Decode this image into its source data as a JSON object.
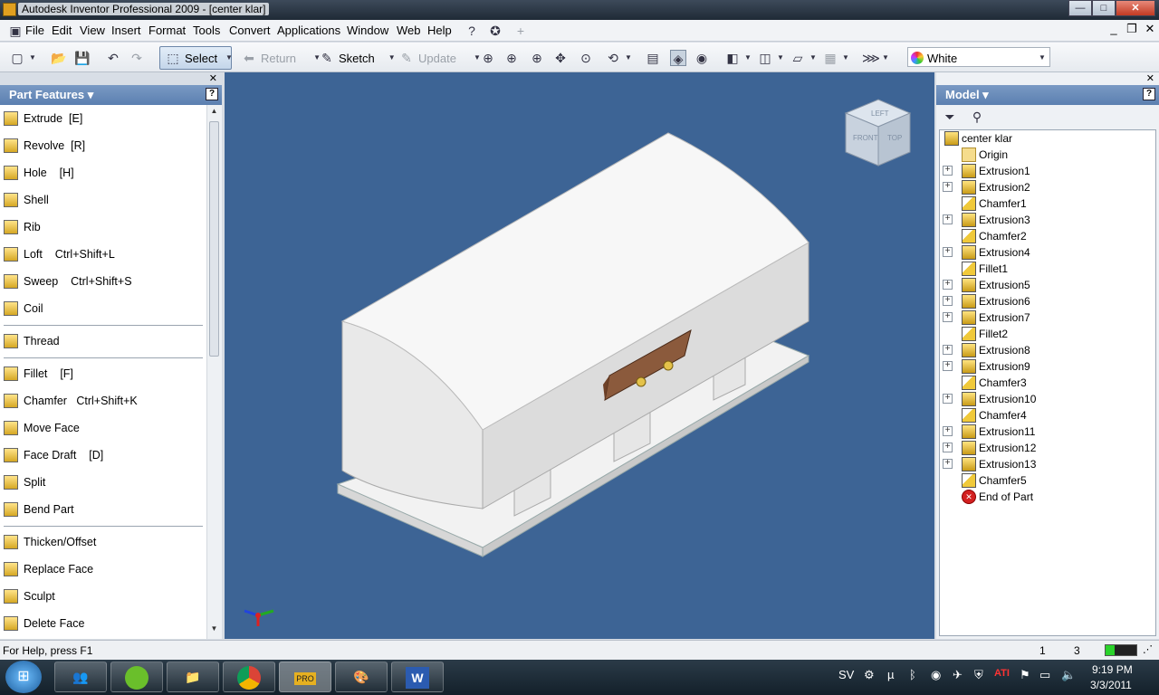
{
  "window": {
    "title": "Autodesk Inventor Professional 2009 - [center klar]",
    "min": "—",
    "max": "□",
    "close": "✕"
  },
  "menu": [
    "File",
    "Edit",
    "View",
    "Insert",
    "Format",
    "Tools",
    "Convert",
    "Applications",
    "Window",
    "Web",
    "Help"
  ],
  "mdi": {
    "min": "_",
    "restore": "❐",
    "close": "✕"
  },
  "toolbar": {
    "select": "Select",
    "return": "Return",
    "sketch": "Sketch",
    "update": "Update",
    "color": "White"
  },
  "features_panel": {
    "title": "Part Features ▾",
    "help": "?",
    "items": [
      {
        "label": "Extrude",
        "key": "[E]"
      },
      {
        "label": "Revolve",
        "key": "[R]"
      },
      {
        "label": "Hole",
        "key": "[H]"
      },
      {
        "label": "Shell",
        "key": ""
      },
      {
        "label": "Rib",
        "key": ""
      },
      {
        "label": "Loft",
        "key": "Ctrl+Shift+L"
      },
      {
        "label": "Sweep",
        "key": "Ctrl+Shift+S"
      },
      {
        "label": "Coil",
        "key": ""
      },
      {
        "label": "Thread",
        "key": ""
      },
      {
        "label": "Fillet",
        "key": "[F]"
      },
      {
        "label": "Chamfer",
        "key": "Ctrl+Shift+K"
      },
      {
        "label": "Move Face",
        "key": ""
      },
      {
        "label": "Face Draft",
        "key": "[D]"
      },
      {
        "label": "Split",
        "key": ""
      },
      {
        "label": "Bend Part",
        "key": ""
      },
      {
        "label": "Thicken/Offset",
        "key": ""
      },
      {
        "label": "Replace Face",
        "key": ""
      },
      {
        "label": "Sculpt",
        "key": ""
      },
      {
        "label": "Delete Face",
        "key": ""
      }
    ]
  },
  "viewcube": {
    "left": "LEFT",
    "front": "FRONT",
    "top": "TOP"
  },
  "model_panel": {
    "title": "Model ▾",
    "help": "?",
    "root": "center klar",
    "items": [
      {
        "label": "Origin",
        "type": "folder"
      },
      {
        "label": "Extrusion1",
        "type": "part"
      },
      {
        "label": "Extrusion2",
        "type": "part"
      },
      {
        "label": "Chamfer1",
        "type": "chamf"
      },
      {
        "label": "Extrusion3",
        "type": "part"
      },
      {
        "label": "Chamfer2",
        "type": "chamf"
      },
      {
        "label": "Extrusion4",
        "type": "part"
      },
      {
        "label": "Fillet1",
        "type": "chamf"
      },
      {
        "label": "Extrusion5",
        "type": "part"
      },
      {
        "label": "Extrusion6",
        "type": "part"
      },
      {
        "label": "Extrusion7",
        "type": "part"
      },
      {
        "label": "Fillet2",
        "type": "chamf"
      },
      {
        "label": "Extrusion8",
        "type": "part"
      },
      {
        "label": "Extrusion9",
        "type": "part"
      },
      {
        "label": "Chamfer3",
        "type": "chamf"
      },
      {
        "label": "Extrusion10",
        "type": "part"
      },
      {
        "label": "Chamfer4",
        "type": "chamf"
      },
      {
        "label": "Extrusion11",
        "type": "part"
      },
      {
        "label": "Extrusion12",
        "type": "part"
      },
      {
        "label": "Extrusion13",
        "type": "part"
      },
      {
        "label": "Chamfer5",
        "type": "chamf"
      },
      {
        "label": "End of Part",
        "type": "end"
      }
    ]
  },
  "status": {
    "help": "For Help, press F1",
    "n1": "1",
    "n2": "3"
  },
  "taskbar": {
    "lang": "SV",
    "time": "9:19 PM",
    "date": "3/3/2011",
    "pro": "PRO"
  }
}
